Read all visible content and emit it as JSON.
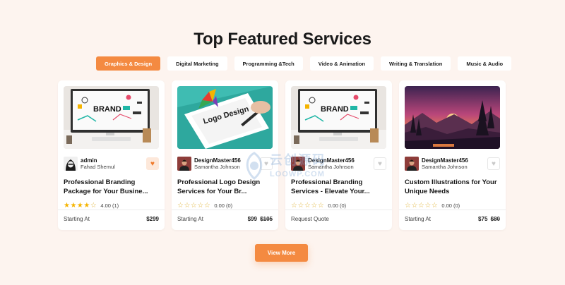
{
  "section_title": "Top Featured Services",
  "tabs": [
    {
      "label": "Graphics & Design",
      "active": true
    },
    {
      "label": "Digital Marketing",
      "active": false
    },
    {
      "label": "Programming &Tech",
      "active": false
    },
    {
      "label": "Video & Animation",
      "active": false
    },
    {
      "label": "Writing & Translation",
      "active": false
    },
    {
      "label": "Music & Audio",
      "active": false
    }
  ],
  "cards": [
    {
      "image": "brand-monitor",
      "seller_name": "admin",
      "seller_sub": "Fahad Shemul",
      "avatar": "hacker-avatar",
      "favorited": true,
      "title": "Professional Branding Package for Your Busine...",
      "rating_stars": 4,
      "rating_text": "4.00 (1)",
      "footer_label": "Starting At",
      "price": "$299",
      "old_price": ""
    },
    {
      "image": "logo-design-tablet",
      "seller_name": "DesignMaster456",
      "seller_sub": "Samantha Johnson",
      "avatar": "portrait-avatar",
      "favorited": false,
      "title": "Professional Logo Design Services for Your Br...",
      "rating_stars": 0,
      "rating_text": "0.00 (0)",
      "footer_label": "Starting At",
      "price": "$99",
      "old_price": "$105"
    },
    {
      "image": "brand-monitor",
      "seller_name": "DesignMaster456",
      "seller_sub": "Samantha Johnson",
      "avatar": "portrait-avatar",
      "favorited": false,
      "title": "Professional Branding Services - Elevate Your...",
      "rating_stars": 0,
      "rating_text": "0.00 (0)",
      "footer_label": "Request Quote",
      "price": "",
      "old_price": ""
    },
    {
      "image": "sunset-landscape",
      "seller_name": "DesignMaster456",
      "seller_sub": "Samantha Johnson",
      "avatar": "portrait-avatar",
      "favorited": false,
      "title": "Custom Illustrations for Your Unique Needs",
      "rating_stars": 0,
      "rating_text": "0.00 (0)",
      "footer_label": "Starting At",
      "price": "$75",
      "old_price": "$80"
    }
  ],
  "view_more_label": "View More",
  "watermark": {
    "main": "云创源码",
    "sub": "LOOWP.COM"
  },
  "colors": {
    "accent": "#f48a41",
    "background": "#fdf4ef",
    "star": "#f5b400"
  }
}
